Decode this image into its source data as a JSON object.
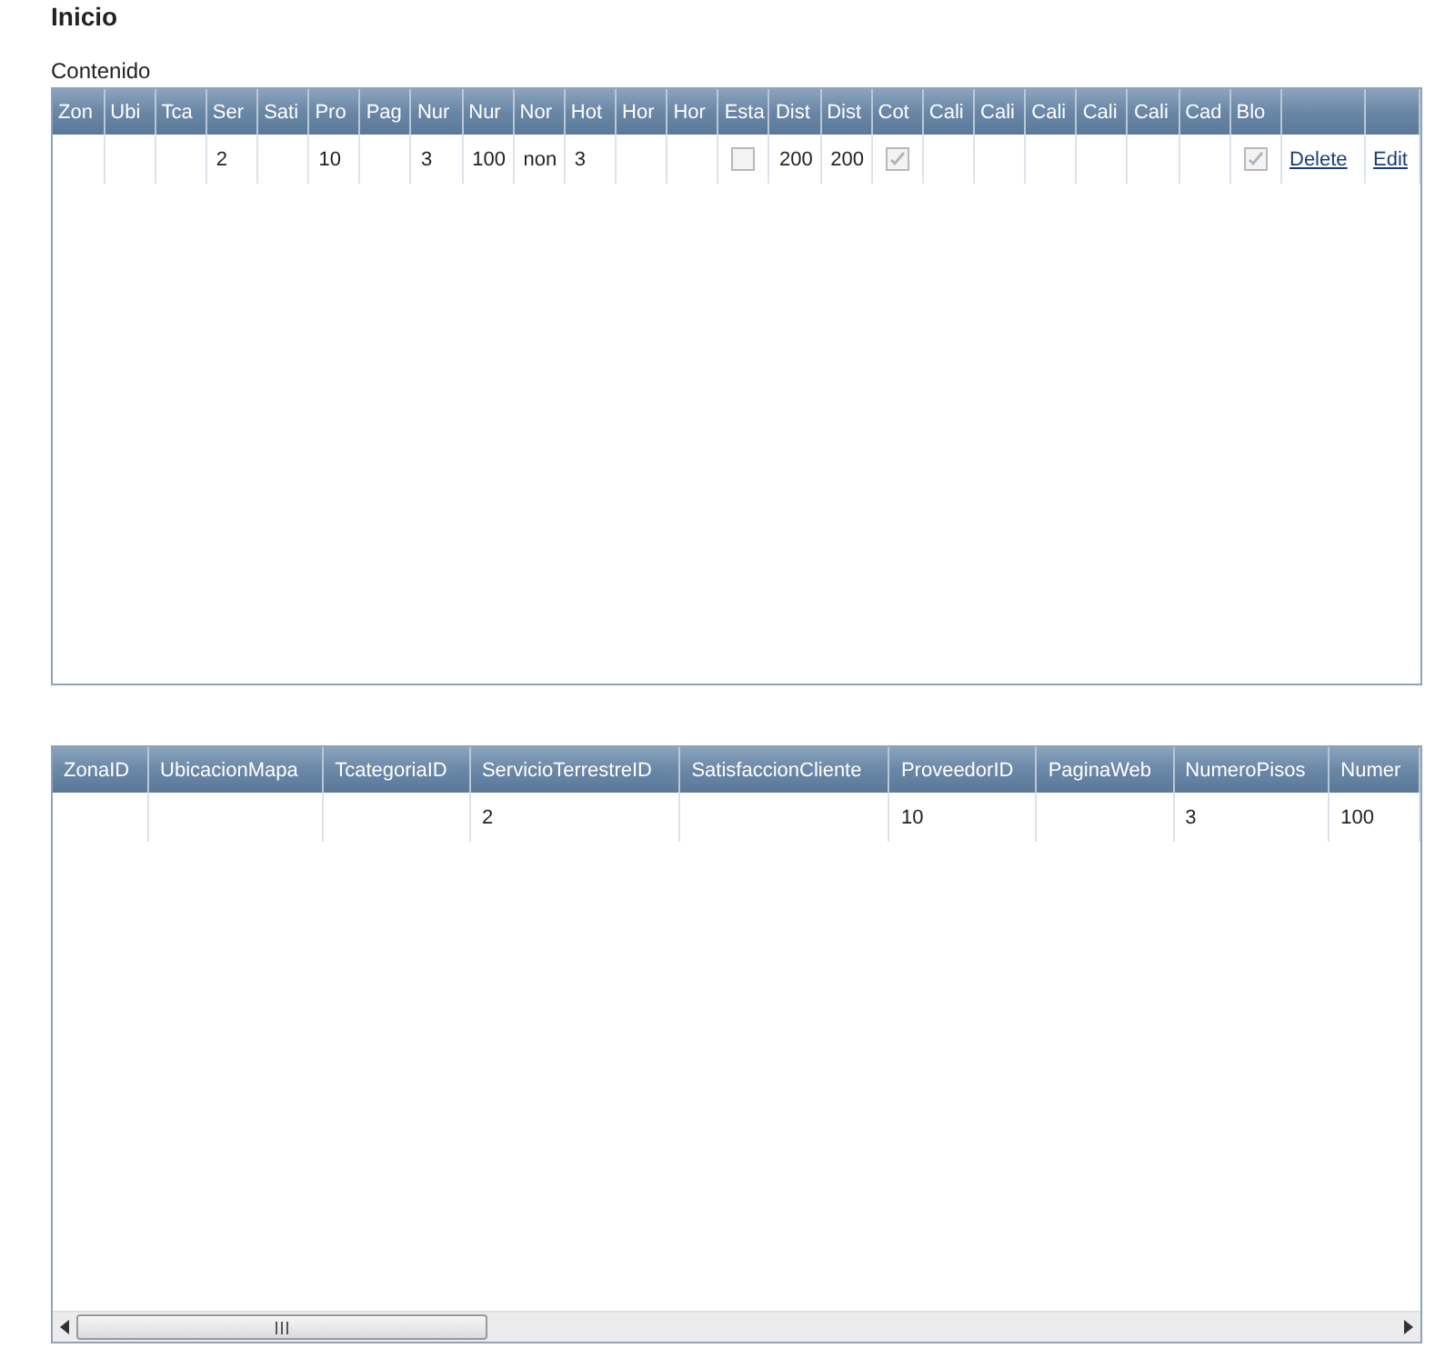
{
  "page_title": "Inicio",
  "section_label": "Contenido",
  "grid_compact": {
    "columns": [
      {
        "header": "Zon",
        "kind": "text"
      },
      {
        "header": "Ubi",
        "kind": "text"
      },
      {
        "header": "Tca",
        "kind": "text"
      },
      {
        "header": "Ser",
        "kind": "text"
      },
      {
        "header": "Sati",
        "kind": "text"
      },
      {
        "header": "Pro",
        "kind": "text"
      },
      {
        "header": "Pag",
        "kind": "text"
      },
      {
        "header": "Nur",
        "kind": "text"
      },
      {
        "header": "Nur",
        "kind": "text"
      },
      {
        "header": "Nor",
        "kind": "text"
      },
      {
        "header": "Hot",
        "kind": "text"
      },
      {
        "header": "Hor",
        "kind": "text"
      },
      {
        "header": "Hor",
        "kind": "text"
      },
      {
        "header": "Esta",
        "kind": "checkbox"
      },
      {
        "header": "Dist",
        "kind": "text"
      },
      {
        "header": "Dist",
        "kind": "text"
      },
      {
        "header": "Cot",
        "kind": "checkbox"
      },
      {
        "header": "Cali",
        "kind": "text"
      },
      {
        "header": "Cali",
        "kind": "text"
      },
      {
        "header": "Cali",
        "kind": "text"
      },
      {
        "header": "Cali",
        "kind": "text"
      },
      {
        "header": "Cali",
        "kind": "text"
      },
      {
        "header": "Cad",
        "kind": "text"
      },
      {
        "header": "Blo",
        "kind": "checkbox"
      },
      {
        "kind": "link"
      },
      {
        "kind": "link"
      }
    ],
    "rows": [
      {
        "cells": [
          {
            "text": ""
          },
          {
            "text": ""
          },
          {
            "text": ""
          },
          {
            "text": "2"
          },
          {
            "text": ""
          },
          {
            "text": "10"
          },
          {
            "text": ""
          },
          {
            "text": "3"
          },
          {
            "text": "100"
          },
          {
            "text": "non"
          },
          {
            "text": "3"
          },
          {
            "text": ""
          },
          {
            "text": ""
          },
          {
            "checked": false
          },
          {
            "text": "200"
          },
          {
            "text": "200"
          },
          {
            "checked": true
          },
          {
            "text": ""
          },
          {
            "text": ""
          },
          {
            "text": ""
          },
          {
            "text": ""
          },
          {
            "text": ""
          },
          {
            "text": ""
          },
          {
            "checked": true
          },
          {
            "text": "Delete"
          },
          {
            "text": "Edit"
          }
        ]
      }
    ]
  },
  "grid_full": {
    "columns": [
      "ZonaID",
      "UbicacionMapa",
      "TcategoriaID",
      "ServicioTerrestreID",
      "SatisfaccionCliente",
      "ProveedorID",
      "PaginaWeb",
      "NumeroPisos",
      "Numer"
    ],
    "rows": [
      {
        "cells": [
          "",
          "",
          "",
          "2",
          "",
          "10",
          "",
          "3",
          "100"
        ]
      }
    ]
  }
}
